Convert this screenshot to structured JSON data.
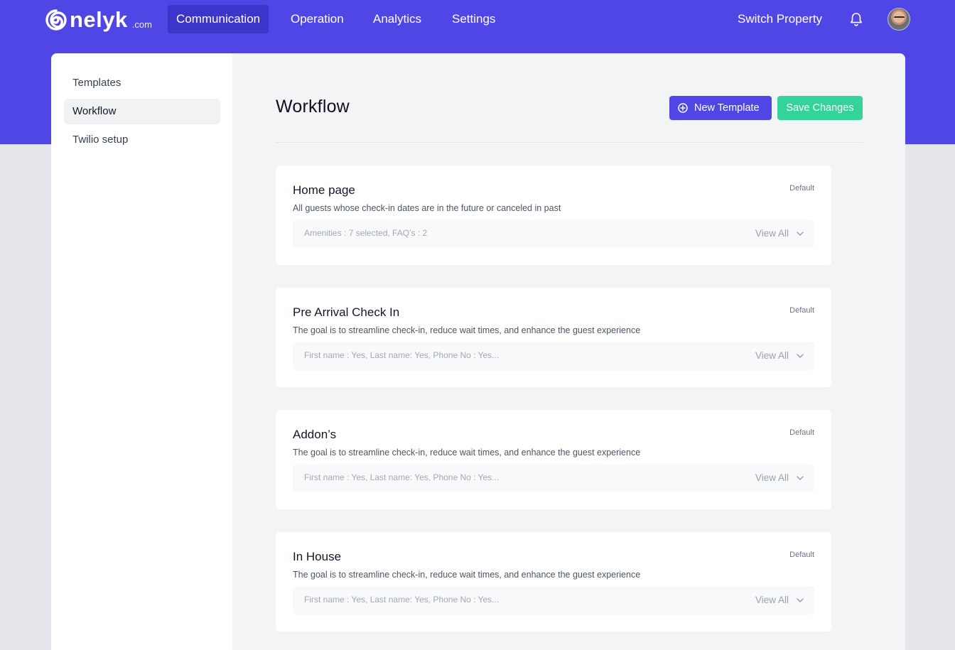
{
  "brand": {
    "logo_text": "nelyk",
    "logo_tld": ".com"
  },
  "nav": {
    "tabs": [
      "Communication",
      "Operation",
      "Analytics",
      "Settings"
    ],
    "switch_property": "Switch Property"
  },
  "sidebar": {
    "items": [
      "Templates",
      "Workflow",
      "Twilio setup"
    ]
  },
  "main": {
    "title": "Workflow",
    "new_template_label": "New Template",
    "save_label": "Save Changes"
  },
  "cards": [
    {
      "title": "Home page",
      "badge": "Default",
      "description": "All guests whose check-in dates are in the future or canceled in past",
      "summary": "Amenities : 7 selected, FAQ’s : 2",
      "view_all": "View All"
    },
    {
      "title": "Pre Arrival Check In",
      "badge": "Default",
      "description": "The goal is to streamline check-in, reduce wait times, and enhance the guest experience",
      "summary": "First name : Yes, Last name: Yes, Phone No : Yes...",
      "view_all": "View All"
    },
    {
      "title": "Addon’s",
      "badge": "Default",
      "description": "The goal is to streamline check-in, reduce wait times, and enhance the guest experience",
      "summary": "First name : Yes, Last name: Yes, Phone No : Yes...",
      "view_all": "View All"
    },
    {
      "title": "In House",
      "badge": "Default",
      "description": "The goal is to streamline check-in, reduce wait times, and enhance the guest experience",
      "summary": "First name : Yes, Last name: Yes, Phone No : Yes...",
      "view_all": "View All"
    }
  ],
  "colors": {
    "brand_primary": "#4f46e5",
    "save_green": "#34d399",
    "nav_active": "#3d34c9"
  },
  "icons": [
    "logo-spiral",
    "bell-icon",
    "plus-circle-icon",
    "chevron-down-icon"
  ]
}
